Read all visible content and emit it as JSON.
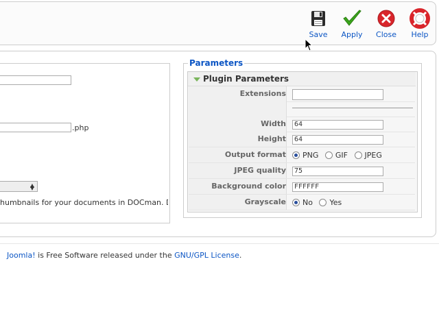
{
  "toolbar": {
    "save": "Save",
    "apply": "Apply",
    "close": "Close",
    "help": "Help"
  },
  "left": {
    "php_suffix": ".php",
    "description": "humbnails for your documents in DOCman. Don't"
  },
  "parameters": {
    "legend": "Parameters",
    "panel_title": "Plugin Parameters",
    "extensions_label": "Extensions",
    "extensions_value": "",
    "width_label": "Width",
    "width_value": "64",
    "height_label": "Height",
    "height_value": "64",
    "format_label": "Output format",
    "format_options": [
      "PNG",
      "GIF",
      "JPEG"
    ],
    "format_selected": "PNG",
    "jpeg_label": "JPEG quality",
    "jpeg_value": "75",
    "bg_label": "Background color",
    "bg_value": "FFFFFF",
    "grayscale_label": "Grayscale",
    "grayscale_options": [
      "No",
      "Yes"
    ],
    "grayscale_selected": "No"
  },
  "footer": {
    "link1": "Joomla!",
    "middle": " is Free Software released under the ",
    "link2": "GNU/GPL License",
    "end": "."
  },
  "colors": {
    "link": "#0B55C4",
    "apply_green": "#3aa51c",
    "close_red": "#d9252b"
  }
}
